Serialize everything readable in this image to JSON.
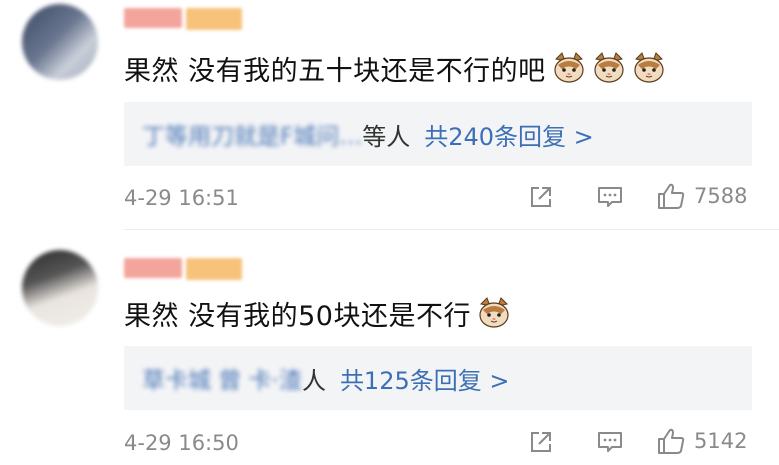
{
  "comments": [
    {
      "username_blur": "",
      "text": "果然 没有我的五十块还是不行的吧",
      "emoji_count": 3,
      "emoji_icon": "cat-face-icon",
      "reply_names": "丁等用刀就是F城问…",
      "reply_suffix": "等人",
      "reply_count": "共240条回复 >",
      "time": "4-29 16:51",
      "likes": "7588"
    },
    {
      "username_blur": "",
      "text": "果然 没有我的50块还是不行",
      "emoji_count": 1,
      "emoji_icon": "cat-face-icon",
      "reply_names": "草卡城 曾 卡·渣",
      "reply_suffix": "人",
      "reply_count": "共125条回复 >",
      "time": "4-29 16:50",
      "likes": "5142"
    }
  ],
  "colors": {
    "link": "#3d6fb6",
    "meta": "#8a8a8a",
    "reply_bg": "#f3f4f6"
  },
  "icons": [
    "share-icon",
    "comment-icon",
    "thumbs-up-icon"
  ]
}
